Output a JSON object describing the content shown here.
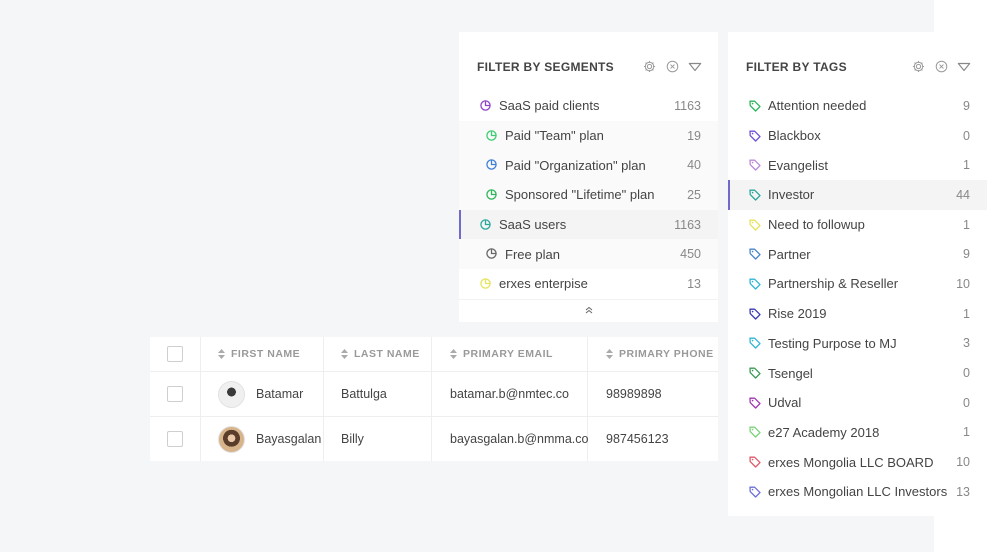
{
  "segments": {
    "title": "FILTER BY SEGMENTS",
    "items": [
      {
        "label": "SaaS paid clients",
        "count": "1163",
        "color": "#8e44c9"
      },
      {
        "label": "Paid \"Team\" plan",
        "count": "19",
        "color": "#3ccc74"
      },
      {
        "label": "Paid \"Organization\" plan",
        "count": "40",
        "color": "#3f7fd9"
      },
      {
        "label": "Sponsored \"Lifetime\" plan",
        "count": "25",
        "color": "#2eb45a"
      },
      {
        "label": "SaaS users",
        "count": "1163",
        "color": "#2aa79b"
      },
      {
        "label": "Free plan",
        "count": "450",
        "color": "#666666"
      },
      {
        "label": "erxes enterpise",
        "count": "13",
        "color": "#e6e35c"
      }
    ],
    "collapse_icon": "chevrons-up-icon"
  },
  "tags": {
    "title": "FILTER BY TAGS",
    "items": [
      {
        "label": "Attention needed",
        "count": "9",
        "color": "#2eb45a"
      },
      {
        "label": "Blackbox",
        "count": "0",
        "color": "#6d4fd8"
      },
      {
        "label": "Evangelist",
        "count": "1",
        "color": "#b889d9"
      },
      {
        "label": "Investor",
        "count": "44",
        "color": "#2aa79b"
      },
      {
        "label": "Need to followup",
        "count": "1",
        "color": "#e6e35c"
      },
      {
        "label": "Partner",
        "count": "9",
        "color": "#4a86c8"
      },
      {
        "label": "Partnership & Reseller",
        "count": "10",
        "color": "#2fb5d8"
      },
      {
        "label": "Rise 2019",
        "count": "1",
        "color": "#3a3ab5"
      },
      {
        "label": "Testing Purpose to MJ",
        "count": "3",
        "color": "#2fb5d8"
      },
      {
        "label": "Tsengel",
        "count": "0",
        "color": "#3a9a54"
      },
      {
        "label": "Udval",
        "count": "0",
        "color": "#a236b5"
      },
      {
        "label": "e27 Academy 2018",
        "count": "1",
        "color": "#7bd37b"
      },
      {
        "label": "erxes Mongolia LLC BOARD",
        "count": "10",
        "color": "#e05a6a"
      },
      {
        "label": "erxes Mongolian LLC Investors",
        "count": "13",
        "color": "#6d6fd8"
      }
    ]
  },
  "table": {
    "headers": [
      "FIRST NAME",
      "LAST NAME",
      "PRIMARY EMAIL",
      "PRIMARY PHONE"
    ],
    "rows": [
      {
        "first": "Batamar",
        "last": "Battulga",
        "email": "batamar.b@nmtec.co",
        "phone": "98989898"
      },
      {
        "first": "Bayasgalan",
        "last": "Billy",
        "email": "bayasgalan.b@nmma.co",
        "phone": "987456123"
      }
    ]
  },
  "icons": {
    "settings": "gear-icon",
    "clear": "close-circle-icon",
    "toggle": "chevron-down-icon",
    "segment": "pie-chart-icon",
    "tag": "tag-icon",
    "sort": "sort-icon"
  }
}
